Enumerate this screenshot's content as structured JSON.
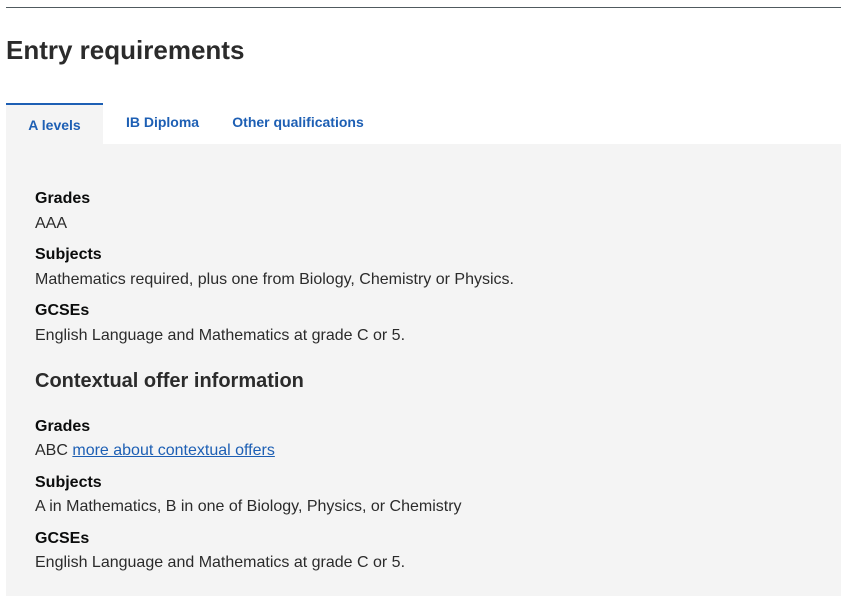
{
  "page": {
    "title": "Entry requirements"
  },
  "tabs": [
    {
      "label": "A levels",
      "active": true
    },
    {
      "label": "IB Diploma",
      "active": false
    },
    {
      "label": "Other qualifications",
      "active": false
    }
  ],
  "standard": {
    "grades_label": "Grades",
    "grades_value": "AAA",
    "subjects_label": "Subjects",
    "subjects_value": "Mathematics required, plus one from Biology, Chemistry or Physics.",
    "gcses_label": "GCSEs",
    "gcses_value": "English Language and Mathematics at grade C or 5."
  },
  "contextual": {
    "heading": "Contextual offer information",
    "grades_label": "Grades",
    "grades_value": "ABC",
    "grades_link": "more about contextual offers",
    "subjects_label": "Subjects",
    "subjects_value": "A in Mathematics, B in one of Biology, Physics, or Chemistry",
    "gcses_label": "GCSEs",
    "gcses_value": "English Language and Mathematics at grade C or 5."
  },
  "colors": {
    "link": "#1d5fb4",
    "panel_background": "#f4f4f4",
    "text": "#0b0c0c"
  }
}
